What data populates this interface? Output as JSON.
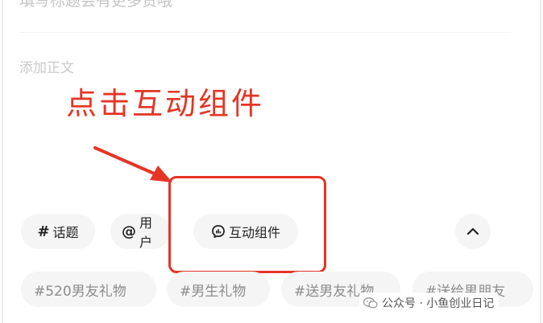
{
  "editor": {
    "title_placeholder": "填写标题会有更多赞哦",
    "body_placeholder": "添加正文"
  },
  "annotation": {
    "text": "点击互动组件",
    "color": "#e53525"
  },
  "toolbar": {
    "topic_icon": "#",
    "topic_label": "话题",
    "user_icon": "@",
    "user_label": "用户",
    "widget_label": "互动组件"
  },
  "tags": [
    "#520男友礼物",
    "#男生礼物",
    "#送男友礼物",
    "#送给男朋友"
  ],
  "watermark": {
    "text": "公众号 · 小鱼创业日记"
  },
  "icons": {
    "widget": "chart-bubble-icon",
    "collapse": "chevron-up-icon",
    "watermark": "wechat-icon"
  }
}
